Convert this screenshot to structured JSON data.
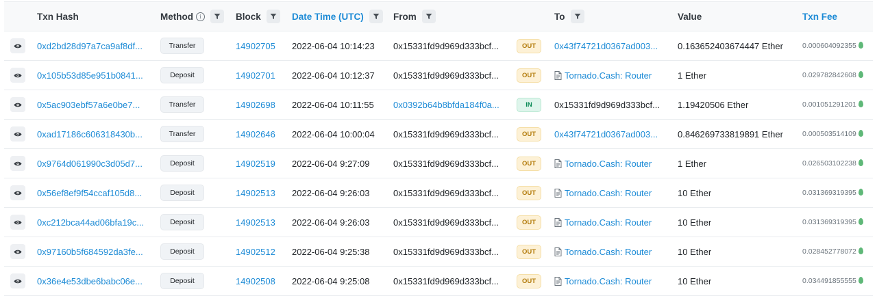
{
  "headers": {
    "txn_hash": "Txn Hash",
    "method": "Method",
    "block": "Block",
    "datetime": "Date Time (UTC)",
    "from": "From",
    "to": "To",
    "value": "Value",
    "txn_fee": "Txn Fee"
  },
  "rows": [
    {
      "hash": "0xd2bd28d97a7ca9af8df...",
      "method": "Transfer",
      "block": "14902705",
      "datetime": "2022-06-04 10:14:23",
      "from": "0x15331fd9d969d333bcf...",
      "from_link": false,
      "dir": "OUT",
      "to": "0x43f74721d0367ad003...",
      "to_contract": false,
      "to_link": true,
      "value": "0.163652403674447 Ether",
      "fee": "0.000604092355"
    },
    {
      "hash": "0x105b53d85e951b0841...",
      "method": "Deposit",
      "block": "14902701",
      "datetime": "2022-06-04 10:12:37",
      "from": "0x15331fd9d969d333bcf...",
      "from_link": false,
      "dir": "OUT",
      "to": "Tornado.Cash: Router",
      "to_contract": true,
      "to_link": true,
      "value": "1 Ether",
      "fee": "0.029782842608"
    },
    {
      "hash": "0x5ac903ebf57a6e0be7...",
      "method": "Transfer",
      "block": "14902698",
      "datetime": "2022-06-04 10:11:55",
      "from": "0x0392b64b8bfda184f0a...",
      "from_link": true,
      "dir": "IN",
      "to": "0x15331fd9d969d333bcf...",
      "to_contract": false,
      "to_link": false,
      "value": "1.19420506 Ether",
      "fee": "0.001051291201"
    },
    {
      "hash": "0xad17186c606318430b...",
      "method": "Transfer",
      "block": "14902646",
      "datetime": "2022-06-04 10:00:04",
      "from": "0x15331fd9d969d333bcf...",
      "from_link": false,
      "dir": "OUT",
      "to": "0x43f74721d0367ad003...",
      "to_contract": false,
      "to_link": true,
      "value": "0.846269733819891 Ether",
      "fee": "0.000503514109"
    },
    {
      "hash": "0x9764d061990c3d05d7...",
      "method": "Deposit",
      "block": "14902519",
      "datetime": "2022-06-04 9:27:09",
      "from": "0x15331fd9d969d333bcf...",
      "from_link": false,
      "dir": "OUT",
      "to": "Tornado.Cash: Router",
      "to_contract": true,
      "to_link": true,
      "value": "1 Ether",
      "fee": "0.026503102238"
    },
    {
      "hash": "0x56ef8ef9f54ccaf105d8...",
      "method": "Deposit",
      "block": "14902513",
      "datetime": "2022-06-04 9:26:03",
      "from": "0x15331fd9d969d333bcf...",
      "from_link": false,
      "dir": "OUT",
      "to": "Tornado.Cash: Router",
      "to_contract": true,
      "to_link": true,
      "value": "10 Ether",
      "fee": "0.031369319395"
    },
    {
      "hash": "0xc212bca44ad06bfa19c...",
      "method": "Deposit",
      "block": "14902513",
      "datetime": "2022-06-04 9:26:03",
      "from": "0x15331fd9d969d333bcf...",
      "from_link": false,
      "dir": "OUT",
      "to": "Tornado.Cash: Router",
      "to_contract": true,
      "to_link": true,
      "value": "10 Ether",
      "fee": "0.031369319395"
    },
    {
      "hash": "0x97160b5f684592da3fe...",
      "method": "Deposit",
      "block": "14902512",
      "datetime": "2022-06-04 9:25:38",
      "from": "0x15331fd9d969d333bcf...",
      "from_link": false,
      "dir": "OUT",
      "to": "Tornado.Cash: Router",
      "to_contract": true,
      "to_link": true,
      "value": "10 Ether",
      "fee": "0.028452778072"
    },
    {
      "hash": "0x36e4e53dbe6babc06e...",
      "method": "Deposit",
      "block": "14902508",
      "datetime": "2022-06-04 9:25:08",
      "from": "0x15331fd9d969d333bcf...",
      "from_link": false,
      "dir": "OUT",
      "to": "Tornado.Cash: Router",
      "to_contract": true,
      "to_link": true,
      "value": "10 Ether",
      "fee": "0.034491855555"
    }
  ],
  "icons": {
    "eye": "eye-icon",
    "filter": "filter-icon",
    "info": "info-icon",
    "contract": "contract-document-icon",
    "gas": "gas-drop-icon"
  },
  "colors": {
    "link": "#1d8bd6",
    "out_bg": "#fdf1d6",
    "out_text": "#b27a0a",
    "in_bg": "#dff5ec",
    "in_text": "#0a8a56",
    "gas": "#5fb878"
  }
}
